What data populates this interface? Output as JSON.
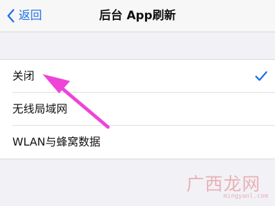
{
  "nav": {
    "back_label": "返回",
    "title": "后台 App刷新"
  },
  "options": [
    {
      "label": "关闭",
      "selected": true
    },
    {
      "label": "无线局域网",
      "selected": false
    },
    {
      "label": "WLAN与蜂窝数据",
      "selected": false
    }
  ],
  "icons": {
    "back": "chevron-left-icon",
    "selected": "checkmark-icon",
    "annotation": "arrow-icon"
  },
  "colors": {
    "accent": "#1b6fe8",
    "annotation_arrow": "#ee44d8",
    "watermark": "#e8a6ae"
  },
  "watermark": {
    "text": "广西龙网",
    "url": "mingyanl.com"
  }
}
